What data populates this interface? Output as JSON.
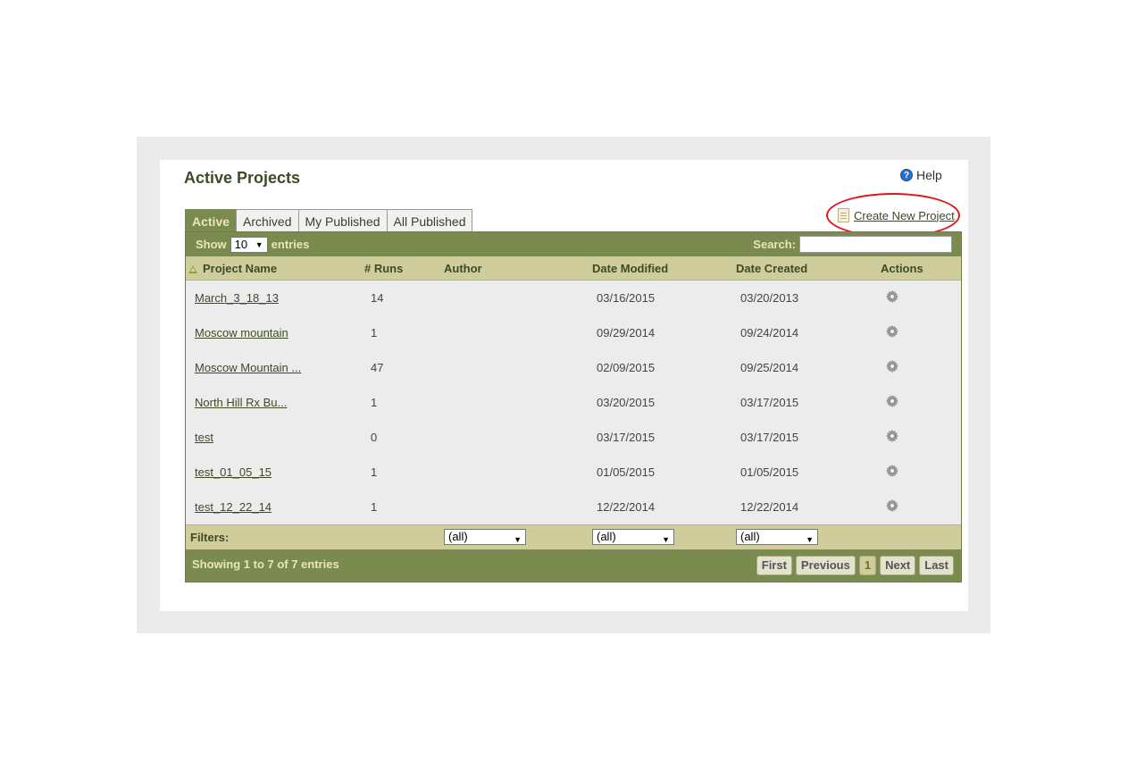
{
  "page": {
    "title": "Active Projects"
  },
  "help": {
    "label": "Help"
  },
  "create": {
    "label": "Create New Project"
  },
  "tabs": [
    {
      "label": "Active",
      "active": true
    },
    {
      "label": "Archived",
      "active": false
    },
    {
      "label": "My Published",
      "active": false
    },
    {
      "label": "All Published",
      "active": false
    }
  ],
  "toolbar": {
    "show_label": "Show",
    "length_value": "10",
    "entries_label": "entries",
    "search_label": "Search:",
    "search_value": ""
  },
  "columns": [
    "Project Name",
    "# Runs",
    "Author",
    "Date Modified",
    "Date Created",
    "Actions"
  ],
  "rows": [
    {
      "name": "March_3_18_13",
      "runs": "14",
      "author": "",
      "modified": "03/16/2015",
      "created": "03/20/2013"
    },
    {
      "name": "Moscow mountain",
      "runs": "1",
      "author": "",
      "modified": "09/29/2014",
      "created": "09/24/2014"
    },
    {
      "name": "Moscow Mountain ...",
      "runs": "47",
      "author": "",
      "modified": "02/09/2015",
      "created": "09/25/2014"
    },
    {
      "name": "North Hill Rx Bu...",
      "runs": "1",
      "author": "",
      "modified": "03/20/2015",
      "created": "03/17/2015"
    },
    {
      "name": "test",
      "runs": "0",
      "author": "",
      "modified": "03/17/2015",
      "created": "03/17/2015"
    },
    {
      "name": "test_01_05_15",
      "runs": "1",
      "author": "",
      "modified": "01/05/2015",
      "created": "01/05/2015"
    },
    {
      "name": "test_12_22_14",
      "runs": "1",
      "author": "",
      "modified": "12/22/2014",
      "created": "12/22/2014"
    }
  ],
  "filters": {
    "label": "Filters:",
    "author": "(all)",
    "modified": "(all)",
    "created": "(all)"
  },
  "footer": {
    "info": "Showing 1 to 7 of 7 entries"
  },
  "pager": {
    "first": "First",
    "previous": "Previous",
    "current": "1",
    "next": "Next",
    "last": "Last"
  },
  "colors": {
    "bar": "#7b8a4f",
    "header": "#cfcd9b",
    "highlight": "#e0141b"
  },
  "icons": {
    "help": "question-circle-icon",
    "create": "document-icon",
    "action": "gear-icon",
    "sort": "sort-ascending-icon"
  }
}
